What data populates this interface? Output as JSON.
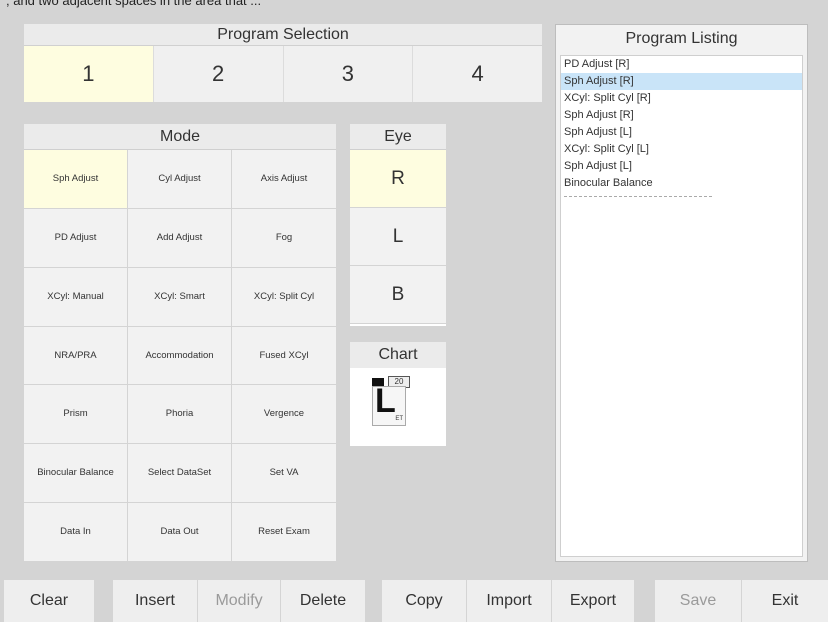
{
  "top_text": "; and two adjacent spaces  in  the  area  that ...",
  "program_selection": {
    "title": "Program Selection",
    "programs": [
      "1",
      "2",
      "3",
      "4"
    ],
    "selected": "1"
  },
  "mode": {
    "title": "Mode",
    "buttons": [
      "Sph Adjust",
      "Cyl Adjust",
      "Axis Adjust",
      "PD Adjust",
      "Add Adjust",
      "Fog",
      "XCyl: Manual",
      "XCyl: Smart",
      "XCyl: Split Cyl",
      "NRA/PRA",
      "Accommodation",
      "Fused XCyl",
      "Prism",
      "Phoria",
      "Vergence",
      "Binocular Balance",
      "Select DataSet",
      "Set VA",
      "Data In",
      "Data Out",
      "Reset Exam"
    ],
    "selected": "Sph Adjust"
  },
  "eye": {
    "title": "Eye",
    "options": [
      "R",
      "L",
      "B"
    ],
    "selected": "R"
  },
  "chart": {
    "title": "Chart",
    "ratio": "20",
    "letter": "L",
    "letter_sub": "ET"
  },
  "program_listing": {
    "title": "Program Listing",
    "items": [
      "PD Adjust [R]",
      "Sph Adjust [R]",
      "XCyl: Split Cyl [R]",
      "Sph Adjust [R]",
      "Sph Adjust [L]",
      "XCyl: Split Cyl [L]",
      "Sph Adjust [L]",
      "Binocular Balance"
    ],
    "selected_index": 1
  },
  "toolbar": {
    "clear": "Clear",
    "insert": "Insert",
    "modify": "Modify",
    "delete": "Delete",
    "copy": "Copy",
    "import": "Import",
    "export": "Export",
    "save": "Save",
    "exit": "Exit"
  },
  "colors": {
    "selected": "#fefde0",
    "list_highlight": "#c9e4f8",
    "background": "#d4d4d4"
  }
}
